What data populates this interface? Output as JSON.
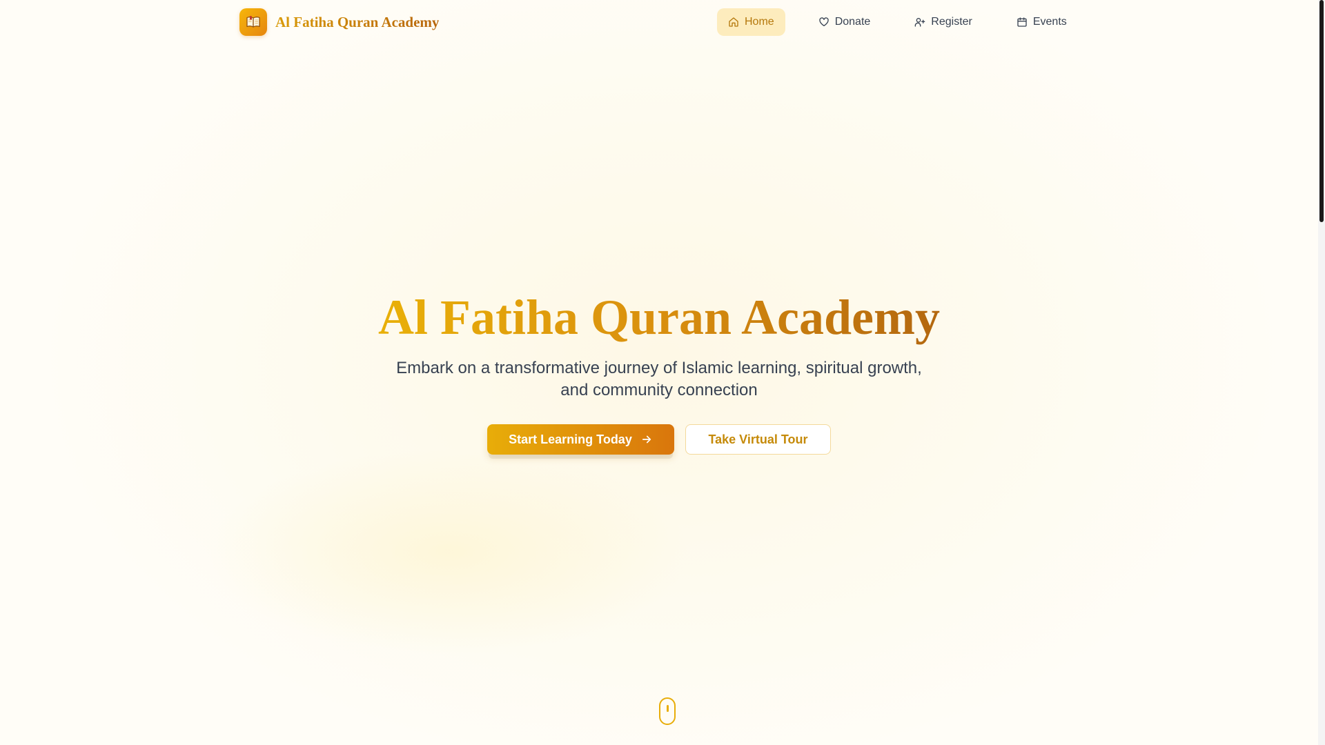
{
  "brand": {
    "name": "Al Fatiha Quran Academy",
    "logo_icon": "open-book-icon"
  },
  "nav": {
    "items": [
      {
        "label": "Home",
        "icon": "home-icon",
        "active": true
      },
      {
        "label": "Donate",
        "icon": "heart-icon",
        "active": false
      },
      {
        "label": "Register",
        "icon": "user-plus-icon",
        "active": false
      },
      {
        "label": "Events",
        "icon": "calendar-icon",
        "active": false
      }
    ]
  },
  "hero": {
    "title": "Al Fatiha Quran Academy",
    "subtitle": "Embark on a transformative journey of Islamic learning, spiritual growth, and community connection",
    "primary_cta": "Start Learning Today",
    "secondary_cta": "Take Virtual Tour"
  },
  "colors": {
    "accent": "#e8ad09",
    "accent_dark": "#d9760c",
    "active_nav_bg": "#fdecbd",
    "text": "#374151"
  }
}
